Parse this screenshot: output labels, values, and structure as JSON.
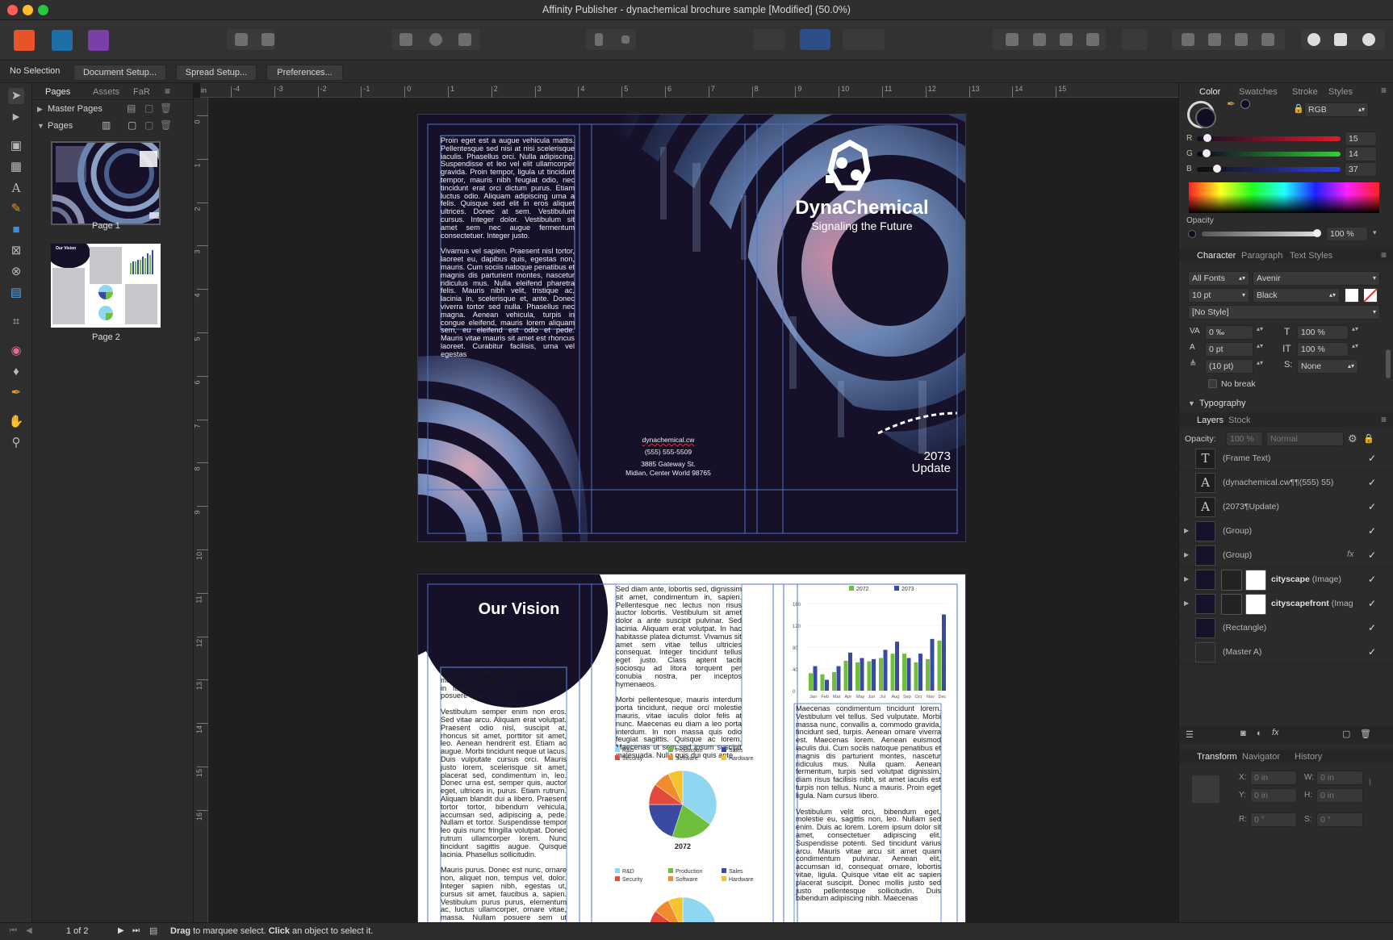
{
  "window": {
    "title": "Affinity Publisher - dynachemical brochure sample [Modified] (50.0%)"
  },
  "context_toolbar": {
    "selection": "No Selection",
    "document_setup": "Document Setup...",
    "spread_setup": "Spread Setup...",
    "preferences": "Preferences..."
  },
  "rulers": {
    "unit": "in",
    "horizontal": [
      "-4",
      "-3",
      "-2",
      "-1",
      "0",
      "1",
      "2",
      "3",
      "4",
      "5",
      "6",
      "7",
      "8",
      "9",
      "10",
      "11",
      "12",
      "13",
      "14",
      "15"
    ],
    "vertical": [
      "0",
      "1",
      "2",
      "3",
      "4",
      "5",
      "6",
      "7",
      "8",
      "9",
      "10",
      "11",
      "12",
      "13",
      "14",
      "15",
      "16"
    ]
  },
  "pages_panel": {
    "tabs": [
      "Pages",
      "Assets",
      "FaR"
    ],
    "master_pages": "Master Pages",
    "pages": "Pages",
    "page1_label": "Page 1",
    "page2_label": "Page 2",
    "thumb_vision": "Our Vision"
  },
  "spread1": {
    "col1_para1": "Proin eget est a augue vehicula mattis. Pellentesque sed nisi at nisi scelerisque iaculis. Phasellus orci. Nulla adipiscing. Suspendisse et leo vel elit ullamcorper gravida. Proin tempor, ligula ut tincidunt tempor, mauris nibh feugiat odio, nec tincidunt erat orci dictum purus. Etiam luctus odio. Aliquam adipiscing urna a felis. Quisque sed elit in eros aliquet ultrices. Donec at sem. Vestibulum cursus. Integer dolor. Vestibulum sit amet sem nec augue fermentum consectetuer. Integer justo.",
    "col1_para2": "Vivamus vel sapien. Praesent nisl tortor, laoreet eu, dapibus quis, egestas non, mauris. Cum sociis natoque penatibus et magnis dis parturient montes, nascetur ridiculus mus. Nulla eleifend pharetra felis. Mauris nibh velit, tristique ac, lacinia in, scelerisque et, ante. Donec viverra tortor sed nulla. Phasellus nec magna. Aenean vehicula, turpis in congue eleifend, mauris lorem aliquam sem, eu eleifend est odio et pede. Mauris vitae mauris sit amet est rhoncus laoreet. Curabitur facilisis, urna vel egestas",
    "website": "dynachemical.cw",
    "phone": "(555) 555-5509",
    "address1": "3885 Gateway St.",
    "address2": "Midian, Center World 98765",
    "brand": "DynaChemical",
    "tagline": "Signaling the Future",
    "year": "2073",
    "update": "Update"
  },
  "spread2": {
    "vision_title": "Our Vision",
    "col1_para1": "Mauris sit amet ligula ut tellus gravida mattis. Vestibulum ante ipsum primis in faucibus orci luctus et ultrices posuere cubilia Curae;",
    "col1_para2": "Vestibulum semper enim non eros. Sed vitae arcu. Aliquam erat volutpat. Praesent odio nisl, suscipit at, rhoncus sit amet, porttitor sit amet, leo. Aenean hendrerit est. Etiam ac augue. Morbi tincidunt neque ut lacus. Duis vulputate cursus orci. Mauris justo lorem, scelerisque sit amet, placerat sed, condimentum in, leo. Donec urna est, semper quis, auctor eget, ultrices in, purus. Etiam rutrum. Aliquam blandit dui a libero. Praesent tortor tortor, bibendum vehicula, accumsan sed, adipiscing a, pede. Nullam et tortor. Suspendisse tempor leo quis nunc fringilla volutpat. Donec rutrum ullamcorper lorem. Nunc tincidunt sagittis augue. Quisque lacinia. Phasellus sollicitudin.",
    "col1_para3": "Mauris purus. Donec est nunc, ornare non, aliquet non, tempus vel, dolor. Integer sapien nibh, egestas ut, cursus sit amet, faucibus a, sapien. Vestibulum purus purus, elementum ac, luctus ullamcorper, ornare vitae, massa. Nullam posuere sem ut mauris. Nullam velit. Quisque sodales.",
    "col2_para1": "Sed diam ante, lobortis sed, dignissim sit amet, condimentum in, sapien. Pellentesque nec lectus non risus auctor lobortis. Vestibulum sit amet dolor a ante suscipit pulvinar. Sed lacinia. Aliquam erat volutpat. In hac habitasse platea dictumst. Vivamus sit amet sem vitae tellus ultricies consequat. Integer tincidunt tellus eget justo. Class aptent taciti sociosqu ad litora torquent per conubia nostra, per inceptos hymenaeos.",
    "col2_para2": "Morbi pellentesque, mauris interdum porta tincidunt, neque orci molestie mauris, vitae iaculis dolor felis at nunc. Maecenas eu diam a leo porta interdum. In non massa quis odio feugiat sagittis. Quisque ac lorem. Maecenas ut sem sed ipsum suscipit malesuada. Nulla quis dui quis ante",
    "col3_para1": "Maecenas condimentum tincidunt lorem. Vestibulum vel tellus. Sed vulputate. Morbi massa nunc, convallis a, commodo gravida, tincidunt sed, turpis. Aenean ornare viverra est. Maecenas lorem. Aenean euismod iaculis dui. Cum sociis natoque penatibus et magnis dis parturient montes, nascetur ridiculus mus. Nulla quam. Aenean fermentum, turpis sed volutpat dignissim, diam risus facilisis nibh, sit amet iaculis est turpis non tellus. Nunc a mauris. Proin eget ligula. Nam cursus libero.",
    "col3_para2": "Vestibulum velit orci, bibendum eget, molestie eu, sagittis non, leo. Nullam sed enim. Duis ac lorem. Lorem ipsum dolor sit amet, consectetuer adipiscing elit. Suspendisse potenti. Sed tincidunt varius arcu. Mauris vitae arcu sit amet quam condimentum pulvinar. Aenean elit, accumsan id, consequat ornare, lobortis vitae, ligula. Quisque vitae elit ac sapien placerat suscipit. Donec mollis justo sed justo pellentesque sollicitudin. Duis bibendum adipiscing nibh. Maecenas"
  },
  "chart_data": [
    {
      "type": "bar",
      "title": "",
      "categories": [
        "Jan",
        "Feb",
        "Mar",
        "Apr",
        "May",
        "Jun",
        "Jul",
        "Aug",
        "Sep",
        "Oct",
        "Nov",
        "Dec"
      ],
      "series": [
        {
          "name": "2072",
          "color": "#6fbf3c",
          "values": [
            32,
            30,
            34,
            55,
            52,
            54,
            60,
            68,
            68,
            52,
            58,
            92
          ]
        },
        {
          "name": "2073",
          "color": "#3a4aa0",
          "values": [
            45,
            20,
            45,
            70,
            60,
            58,
            75,
            90,
            60,
            68,
            95,
            140
          ]
        }
      ],
      "yticks": [
        "160",
        "120",
        "80",
        "40",
        "0"
      ],
      "ylim": [
        0,
        160
      ]
    },
    {
      "type": "pie",
      "title": "2072",
      "legend": [
        "R&D",
        "Production",
        "Sales",
        "Security",
        "Software",
        "Hardware"
      ],
      "slices": [
        {
          "label": "R&D",
          "color": "#8fd6f0",
          "value": 35
        },
        {
          "label": "Production",
          "color": "#6fbf3c",
          "value": 20
        },
        {
          "label": "Sales",
          "color": "#3a4aa0",
          "value": 20
        },
        {
          "label": "Security",
          "color": "#e24b3b",
          "value": 10
        },
        {
          "label": "Software",
          "color": "#f28a2e",
          "value": 8
        },
        {
          "label": "Hardware",
          "color": "#f5c42c",
          "value": 7
        }
      ]
    },
    {
      "type": "pie",
      "title": "",
      "legend": [
        "R&D",
        "Production",
        "Sales",
        "Security",
        "Software",
        "Hardware"
      ]
    }
  ],
  "color_panel": {
    "tabs": [
      "Color",
      "Swatches",
      "Stroke",
      "Styles"
    ],
    "model": "RGB",
    "r_label": "R",
    "g_label": "G",
    "b_label": "B",
    "r": "15",
    "g": "14",
    "b": "37",
    "opacity_label": "Opacity",
    "opacity": "100 %"
  },
  "character_panel": {
    "tabs": [
      "Character",
      "Paragraph",
      "Text Styles"
    ],
    "font_collection": "All Fonts",
    "font_name": "Avenir",
    "font_size": "10 pt",
    "font_weight": "Black",
    "style": "[No Style]",
    "tracking": "0 ‰",
    "baseline": "0 pt",
    "leading": "(10 pt)",
    "vscale": "100 %",
    "hscale": "100 %",
    "shear": "None",
    "nobreak": "No break",
    "typography": "Typography"
  },
  "layers_panel": {
    "tabs": [
      "Layers",
      "Stock"
    ],
    "opacity_label": "Opacity:",
    "opacity": "100 %",
    "blend": "Normal",
    "items": [
      {
        "name": "(Frame Text)",
        "icon": "T"
      },
      {
        "name": "(dynachemical.cw¶¶(555) 55)",
        "icon": "A"
      },
      {
        "name": "(2073¶Update)",
        "icon": "A"
      },
      {
        "name": "(Group)",
        "icon": ""
      },
      {
        "name": "(Group)",
        "icon": ""
      },
      {
        "name": "cityscape",
        "suffix": "(Image)",
        "icon": ""
      },
      {
        "name": "cityscapefront",
        "suffix": "(Imag",
        "icon": ""
      },
      {
        "name": "(Rectangle)",
        "icon": ""
      },
      {
        "name": "(Master A)",
        "icon": ""
      }
    ]
  },
  "transform_panel": {
    "tabs": [
      "Transform",
      "Navigator",
      "History"
    ],
    "x_label": "X:",
    "y_label": "Y:",
    "w_label": "W:",
    "h_label": "H:",
    "r_label": "R:",
    "s_label": "S:",
    "x": "0 in",
    "y": "0 in",
    "w": "0 in",
    "h": "0 in",
    "r": "0 °",
    "s": "0 °"
  },
  "status": {
    "page": "1 of 2",
    "drag": "Drag",
    "drag_text": "to marquee select.",
    "click": "Click",
    "click_text": "an object to select it."
  }
}
